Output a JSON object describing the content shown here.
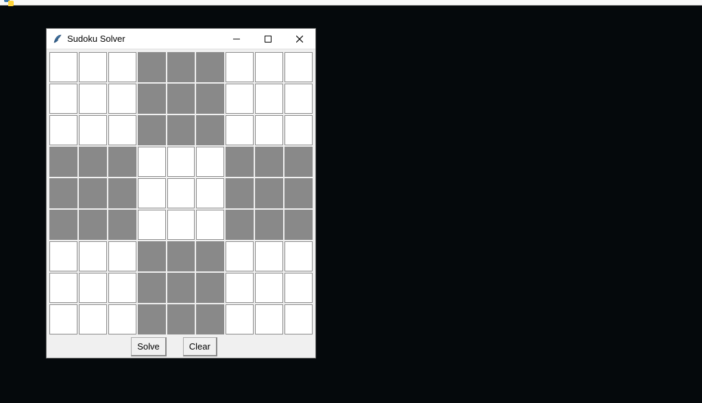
{
  "window": {
    "title": "Sudoku Solver"
  },
  "buttons": {
    "solve": "Solve",
    "clear": "Clear"
  },
  "grid": {
    "rows": 9,
    "cols": 9,
    "shaded_blocks_pattern": "checkerboard-3x3-invert-center",
    "cells": [
      [
        "",
        "",
        "",
        "",
        "",
        "",
        "",
        "",
        ""
      ],
      [
        "",
        "",
        "",
        "",
        "",
        "",
        "",
        "",
        ""
      ],
      [
        "",
        "",
        "",
        "",
        "",
        "",
        "",
        "",
        ""
      ],
      [
        "",
        "",
        "",
        "",
        "",
        "",
        "",
        "",
        ""
      ],
      [
        "",
        "",
        "",
        "",
        "",
        "",
        "",
        "",
        ""
      ],
      [
        "",
        "",
        "",
        "",
        "",
        "",
        "",
        "",
        ""
      ],
      [
        "",
        "",
        "",
        "",
        "",
        "",
        "",
        "",
        ""
      ],
      [
        "",
        "",
        "",
        "",
        "",
        "",
        "",
        "",
        ""
      ],
      [
        "",
        "",
        "",
        "",
        "",
        "",
        "",
        "",
        ""
      ]
    ]
  },
  "colors": {
    "desktop_bg": "#05090c",
    "window_bg": "#f0f0f0",
    "titlebar_bg": "#ffffff",
    "cell_light": "#ffffff",
    "cell_shaded": "#898989",
    "cell_border": "#8a8a8a"
  },
  "icons": {
    "feather": "feather-icon",
    "minimize": "minimize-icon",
    "maximize": "maximize-icon",
    "close": "close-icon"
  }
}
